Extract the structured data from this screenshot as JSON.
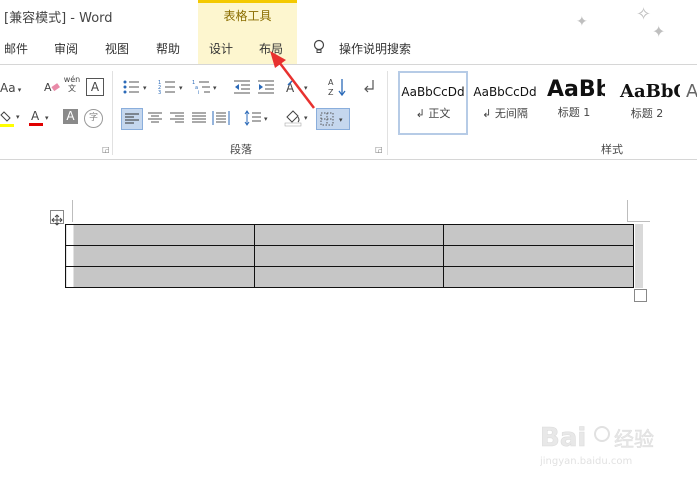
{
  "title_bar": {
    "document_title": "[兼容模式]  -  Word",
    "context_tab_group": "表格工具"
  },
  "menu": {
    "items": [
      "邮件",
      "审阅",
      "视图",
      "帮助",
      "设计",
      "布局"
    ],
    "tell_me": "操作说明搜索"
  },
  "ribbon": {
    "font_group": {
      "font_size_label": "Aa",
      "phonetic_top": "wén",
      "phonetic_bottom": "文",
      "char_border": "A",
      "font_color_letter": "A",
      "char_shading_letter": "A",
      "enclose_char": "字"
    },
    "paragraph_group": {
      "label": "段落",
      "sort_label": "A↓Z"
    },
    "styles_group": {
      "label": "样式",
      "cards": [
        {
          "sample": "AaBbCcDd",
          "name": "↲ 正文"
        },
        {
          "sample": "AaBbCcDd",
          "name": "↲ 无间隔"
        },
        {
          "sample": "AaBb",
          "name": "标题 1"
        },
        {
          "sample": "AaBbC",
          "name": "标题 2"
        },
        {
          "sample": "A",
          "name": ""
        }
      ]
    }
  },
  "table": {
    "rows": 3,
    "cols": 3
  },
  "colors": {
    "context_accent": "#f4c900",
    "context_band": "#fdf6cf",
    "selection_gray": "#c6c6c6",
    "font_color_bar": "#e00000",
    "highlight_bar": "#ffff00",
    "arrow_red": "#e8312f"
  }
}
